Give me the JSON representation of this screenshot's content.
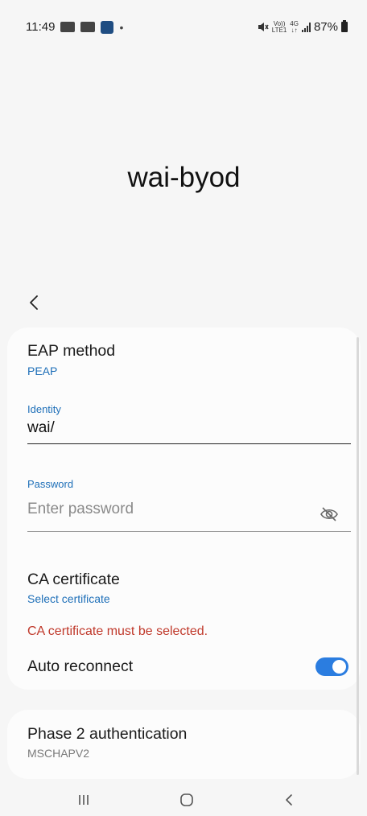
{
  "status_bar": {
    "time": "11:49",
    "volte_text": "Vo))",
    "lte_text": "LTE1",
    "network_type": "4G",
    "battery_percent": "87%"
  },
  "page": {
    "title": "wai-byod"
  },
  "form": {
    "eap_method": {
      "label": "EAP method",
      "value": "PEAP"
    },
    "identity": {
      "label": "Identity",
      "value": "wai/"
    },
    "password": {
      "label": "Password",
      "placeholder": "Enter password"
    },
    "ca_certificate": {
      "label": "CA certificate",
      "value": "Select certificate",
      "error": "CA certificate must be selected."
    },
    "auto_reconnect": {
      "label": "Auto reconnect",
      "enabled": true
    }
  },
  "phase2": {
    "label": "Phase 2 authentication",
    "value": "MSCHAPV2"
  },
  "colors": {
    "accent": "#1e6fb8",
    "toggle_on": "#2b7de0",
    "error": "#c0392b",
    "background": "#f6f6f6",
    "card": "#fcfcfc"
  },
  "icons": {
    "back": "chevron-left-icon",
    "password_visibility": "eye-off-icon",
    "nav_recents": "recents-icon",
    "nav_home": "home-icon",
    "nav_back": "back-icon"
  }
}
